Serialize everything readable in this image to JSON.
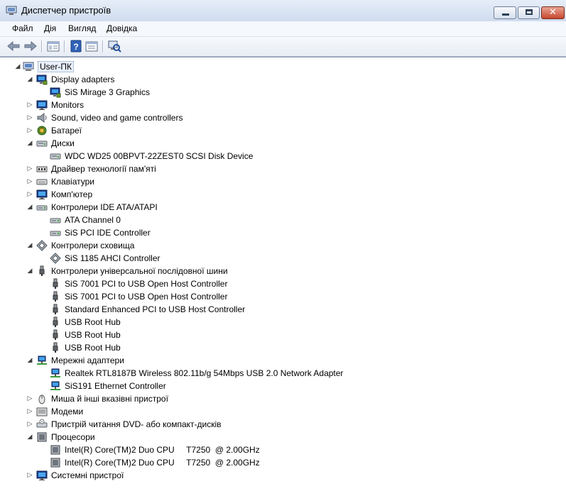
{
  "window": {
    "title": "Диспетчер пристроїв",
    "close_glyph": "✕"
  },
  "menu": [
    "Файл",
    "Дія",
    "Вигляд",
    "Довідка"
  ],
  "toolbar_icons": [
    "back-arrow-icon",
    "forward-arrow-icon",
    "show-hide-console-tree-icon",
    "help-icon",
    "properties-icon",
    "scan-hardware-changes-icon"
  ],
  "tree": [
    {
      "label": "User-ПК",
      "icon": "computer-icon",
      "level": 0,
      "state": "expanded",
      "root": true
    },
    {
      "label": "Display adapters",
      "icon": "display-icon",
      "level": 1,
      "state": "expanded"
    },
    {
      "label": "SiS Mirage 3 Graphics",
      "icon": "display-icon",
      "level": 2,
      "state": "leaf"
    },
    {
      "label": "Monitors",
      "icon": "monitor-icon",
      "level": 1,
      "state": "collapsed"
    },
    {
      "label": "Sound, video and game controllers",
      "icon": "speaker-icon",
      "level": 1,
      "state": "collapsed"
    },
    {
      "label": "Батареї",
      "icon": "battery-icon",
      "level": 1,
      "state": "collapsed"
    },
    {
      "label": "Диски",
      "icon": "disk-icon",
      "level": 1,
      "state": "expanded"
    },
    {
      "label": "WDC WD25 00BPVT-22ZEST0 SCSI Disk Device",
      "icon": "disk-icon",
      "level": 2,
      "state": "leaf"
    },
    {
      "label": "Драйвер технології пам'яті",
      "icon": "memory-icon",
      "level": 1,
      "state": "collapsed"
    },
    {
      "label": "Клавіатури",
      "icon": "keyboard-icon",
      "level": 1,
      "state": "collapsed"
    },
    {
      "label": "Комп'ютер",
      "icon": "monitor-icon",
      "level": 1,
      "state": "collapsed"
    },
    {
      "label": "Контролери IDE ATA/ATAPI",
      "icon": "ide-controller-icon",
      "level": 1,
      "state": "expanded"
    },
    {
      "label": "ATA Channel 0",
      "icon": "ide-controller-icon",
      "level": 2,
      "state": "leaf"
    },
    {
      "label": "SiS PCI IDE Controller",
      "icon": "ide-controller-icon",
      "level": 2,
      "state": "leaf"
    },
    {
      "label": "Контролери сховища",
      "icon": "storage-controller-icon",
      "level": 1,
      "state": "expanded"
    },
    {
      "label": "SiS 1185 AHCI Controller",
      "icon": "storage-controller-icon",
      "level": 2,
      "state": "leaf"
    },
    {
      "label": "Контролери універсальної послідовної шини",
      "icon": "usb-icon",
      "level": 1,
      "state": "expanded"
    },
    {
      "label": "SiS 7001 PCI to USB Open Host Controller",
      "icon": "usb-icon",
      "level": 2,
      "state": "leaf"
    },
    {
      "label": "SiS 7001 PCI to USB Open Host Controller",
      "icon": "usb-icon",
      "level": 2,
      "state": "leaf"
    },
    {
      "label": "Standard Enhanced PCI to USB Host Controller",
      "icon": "usb-icon",
      "level": 2,
      "state": "leaf"
    },
    {
      "label": "USB Root Hub",
      "icon": "usb-icon",
      "level": 2,
      "state": "leaf"
    },
    {
      "label": "USB Root Hub",
      "icon": "usb-icon",
      "level": 2,
      "state": "leaf"
    },
    {
      "label": "USB Root Hub",
      "icon": "usb-icon",
      "level": 2,
      "state": "leaf"
    },
    {
      "label": "Мережні адаптери",
      "icon": "network-icon",
      "level": 1,
      "state": "expanded"
    },
    {
      "label": "Realtek RTL8187B Wireless 802.11b/g 54Mbps USB 2.0 Network Adapter",
      "icon": "network-icon",
      "level": 2,
      "state": "leaf"
    },
    {
      "label": "SiS191 Ethernet Controller",
      "icon": "network-icon",
      "level": 2,
      "state": "leaf"
    },
    {
      "label": "Миша й інші вказівні пристрої",
      "icon": "mouse-icon",
      "level": 1,
      "state": "collapsed"
    },
    {
      "label": "Модеми",
      "icon": "modem-icon",
      "level": 1,
      "state": "collapsed"
    },
    {
      "label": "Пристрій читання DVD- або компакт-дисків",
      "icon": "dvd-drive-icon",
      "level": 1,
      "state": "collapsed"
    },
    {
      "label": "Процесори",
      "icon": "processor-icon",
      "level": 1,
      "state": "expanded"
    },
    {
      "label": "Intel(R) Core(TM)2 Duo CPU     T7250  @ 2.00GHz",
      "icon": "processor-icon",
      "level": 2,
      "state": "leaf"
    },
    {
      "label": "Intel(R) Core(TM)2 Duo CPU     T7250  @ 2.00GHz",
      "icon": "processor-icon",
      "level": 2,
      "state": "leaf"
    },
    {
      "label": "Системні пристрої",
      "icon": "monitor-icon",
      "level": 1,
      "state": "collapsed"
    }
  ]
}
